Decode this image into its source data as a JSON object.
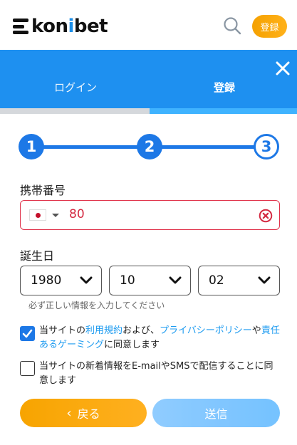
{
  "header": {
    "logo_prefix": "kon",
    "logo_accent": "i",
    "logo_suffix": "bet",
    "register_label": "登録"
  },
  "tabs": {
    "login_label": "ログイン",
    "register_label": "登録"
  },
  "stepper": {
    "steps": [
      "1",
      "2",
      "3"
    ],
    "current": 3
  },
  "form": {
    "phone_label": "携帯番号",
    "phone_value": "80",
    "country": "JP",
    "birthday_label": "誕生日",
    "year": "1980",
    "month": "10",
    "day": "02",
    "hint": "必ず正しい情報を入力してください"
  },
  "consent": {
    "terms": {
      "checked": true,
      "text_1": "当サイトの",
      "link_1": "利用規約",
      "text_2": "および、",
      "link_2": "プライバシーポリシー",
      "text_3": "や",
      "link_3": "責任あるゲーミング",
      "text_4": "に同意します"
    },
    "newsletter": {
      "checked": false,
      "text": "当サイトの新着情報をE-mailやSMSで配信することに同意します"
    }
  },
  "buttons": {
    "back_label": "戻る",
    "submit_label": "送信"
  },
  "colors": {
    "brand_blue": "#1e90f0",
    "accent_orange": "#f7a400",
    "error_red": "#e0324a"
  }
}
